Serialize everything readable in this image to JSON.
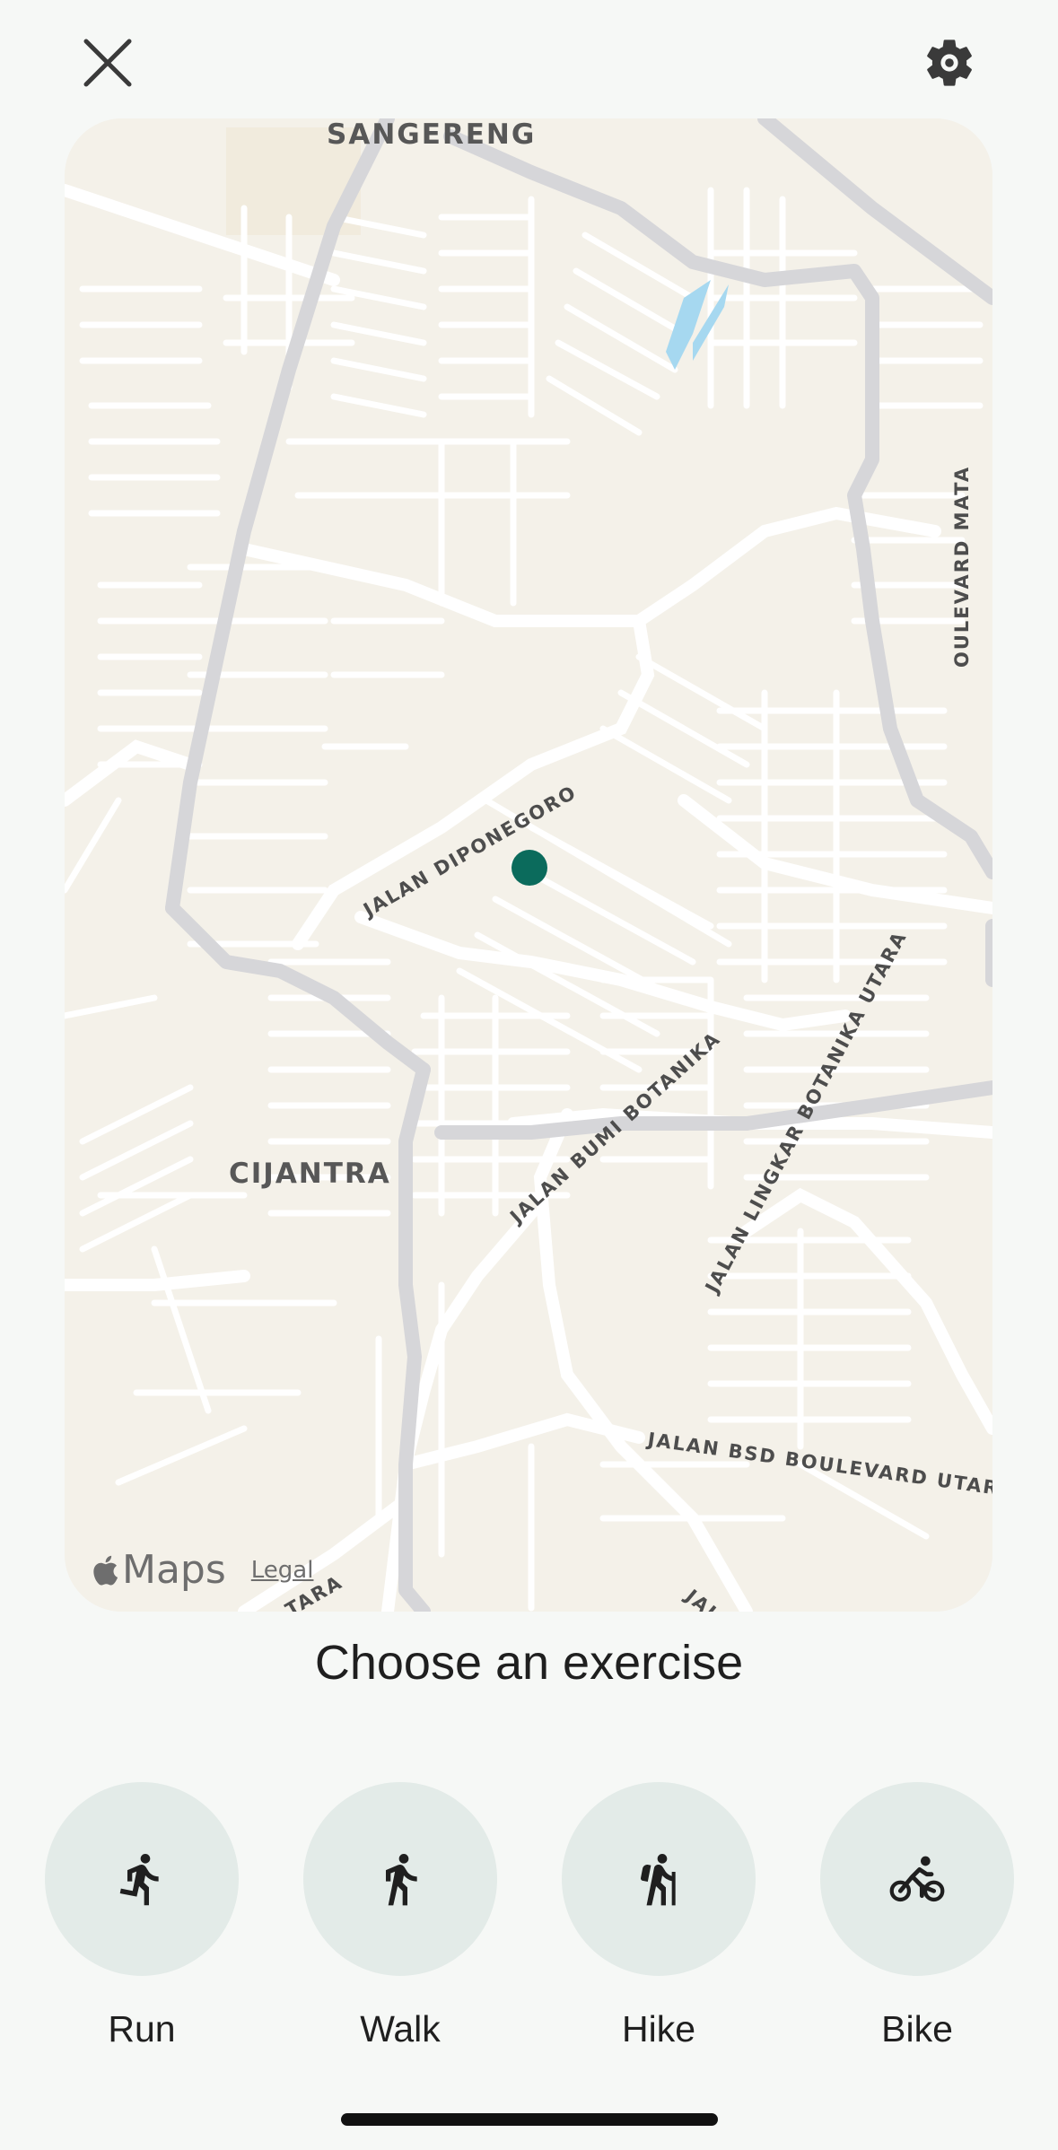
{
  "header": {
    "close_icon": "close-icon",
    "settings_icon": "gear-icon"
  },
  "map": {
    "place_labels": [
      "SANGERENG",
      "CIJANTRA"
    ],
    "street_labels": [
      "JALAN DIPONEGORO",
      "JALAN BUMI BOTANIKA",
      "JALAN LINGKAR BOTANIKA UTARA",
      "JALAN BSD BOULEVARD UTARA",
      "OULEVARD MATA",
      "TARA",
      "JAL"
    ],
    "attribution": {
      "logo_text": "Maps",
      "legal_label": "Legal"
    },
    "colors": {
      "land": "#f4f1e9",
      "road": "#ffffff",
      "major_road": "#d5d5d8",
      "water": "#a6d8f0",
      "location_dot": "#0b6b5c"
    }
  },
  "headline": "Choose an exercise",
  "exercises": [
    {
      "label": "Run",
      "icon": "run-icon"
    },
    {
      "label": "Walk",
      "icon": "walk-icon"
    },
    {
      "label": "Hike",
      "icon": "hike-icon"
    },
    {
      "label": "Bike",
      "icon": "bike-icon"
    }
  ]
}
